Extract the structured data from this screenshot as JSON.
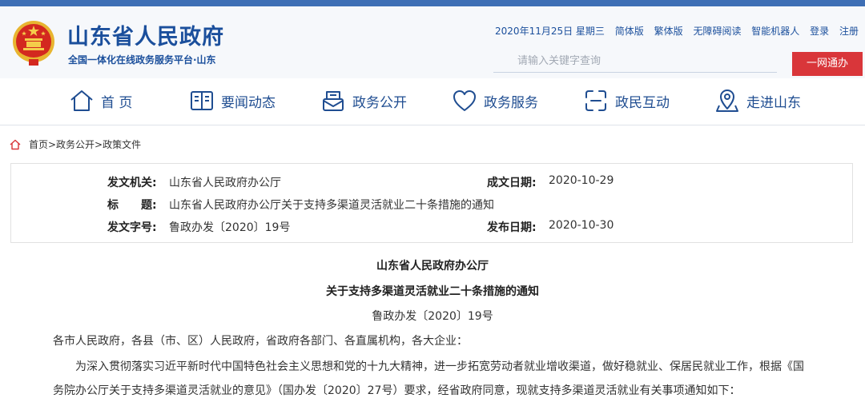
{
  "header": {
    "title": "山东省人民政府",
    "subtitle": "全国一体化在线政务服务平台·山东",
    "date": "2020年11月25日 星期三",
    "links": [
      "简体版",
      "繁体版",
      "无障碍阅读",
      "智能机器人",
      "登录",
      "注册"
    ],
    "search_placeholder": "请输入关键字查询",
    "yiwang_label": "一网通办"
  },
  "nav": {
    "items": [
      {
        "label": "首 页",
        "icon": "home-icon"
      },
      {
        "label": "要闻动态",
        "icon": "news-icon"
      },
      {
        "label": "政务公开",
        "icon": "public-icon"
      },
      {
        "label": "政务服务",
        "icon": "heart-icon"
      },
      {
        "label": "政民互动",
        "icon": "interact-icon"
      },
      {
        "label": "走进山东",
        "icon": "location-icon"
      }
    ]
  },
  "breadcrumb": "首页>政务公开>政策文件",
  "meta": {
    "issuer_label": "发文机关:",
    "issuer": "山东省人民政府办公厅",
    "date_label": "成文日期:",
    "date": "2020-10-29",
    "title_label": "标　　题:",
    "title": "山东省人民政府办公厅关于支持多渠道灵活就业二十条措施的通知",
    "num_label": "发文字号:",
    "num": "鲁政办发〔2020〕19号",
    "pub_label": "发布日期:",
    "pub_date": "2020-10-30"
  },
  "doc": {
    "line1": "山东省人民政府办公厅",
    "line2": "关于支持多渠道灵活就业二十条措施的通知",
    "number": "鲁政办发〔2020〕19号",
    "salutation": "各市人民政府，各县（市、区）人民政府，省政府各部门、各直属机构，各大企业：",
    "para1": "为深入贯彻落实习近平新时代中国特色社会主义思想和党的十九大精神，进一步拓宽劳动者就业增收渠道，做好稳就业、保居民就业工作，根据《国",
    "para2": "务院办公厅关于支持多渠道灵活就业的意见》（国办发〔2020〕27号）要求，经省政府同意，现就支持多渠道灵活就业有关事项通知如下："
  },
  "colors": {
    "brand_blue": "#1b4f9c",
    "top_bar": "#3e6fb5",
    "button_red": "#d9363a"
  }
}
